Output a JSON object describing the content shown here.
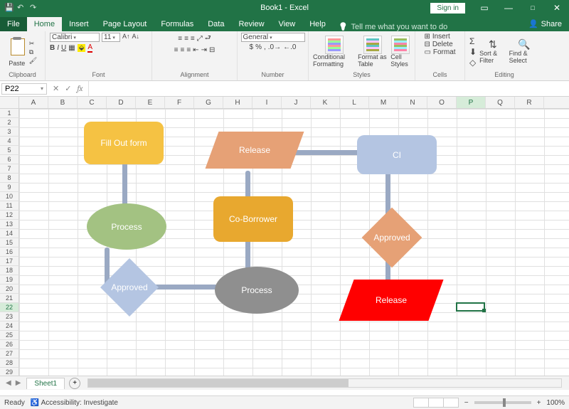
{
  "title": "Book1 - Excel",
  "signin": "Sign in",
  "tabs": {
    "file": "File",
    "home": "Home",
    "insert": "Insert",
    "pagelayout": "Page Layout",
    "formulas": "Formulas",
    "data": "Data",
    "review": "Review",
    "view": "View",
    "help": "Help",
    "tellme": "Tell me what you want to do",
    "share": "Share"
  },
  "ribbon": {
    "clipboard": "Clipboard",
    "paste": "Paste",
    "font_group": "Font",
    "font": "Calibri",
    "fontsize": "11",
    "alignment": "Alignment",
    "number_group": "Number",
    "number_format": "General",
    "styles": "Styles",
    "cond_fmt": "Conditional Formatting",
    "fmt_table": "Format as Table",
    "cell_styles": "Cell Styles",
    "cells": "Cells",
    "insert": "Insert",
    "delete": "Delete",
    "format": "Format",
    "editing": "Editing",
    "sort": "Sort & Filter",
    "find": "Find & Select"
  },
  "namebox": "P22",
  "columns": [
    "A",
    "B",
    "C",
    "D",
    "E",
    "F",
    "G",
    "H",
    "I",
    "J",
    "K",
    "L",
    "M",
    "N",
    "O",
    "P",
    "Q",
    "R"
  ],
  "rows": [
    "1",
    "2",
    "3",
    "4",
    "5",
    "6",
    "7",
    "8",
    "9",
    "10",
    "11",
    "12",
    "13",
    "14",
    "15",
    "16",
    "17",
    "18",
    "19",
    "20",
    "21",
    "22",
    "23",
    "24",
    "25",
    "26",
    "27",
    "28",
    "29"
  ],
  "active_col": "P",
  "active_row": "22",
  "shapes": {
    "fillout": "Fill Out form",
    "process1": "Process",
    "approved1": "Approved",
    "release1": "Release",
    "coborrower": "Co-Borrower",
    "process2": "Process",
    "ci": "CI",
    "approved2": "Approved",
    "release2": "Release"
  },
  "sheet": "Sheet1",
  "status": {
    "ready": "Ready",
    "accessibility": "Accessibility: Investigate",
    "zoom": "100%"
  }
}
